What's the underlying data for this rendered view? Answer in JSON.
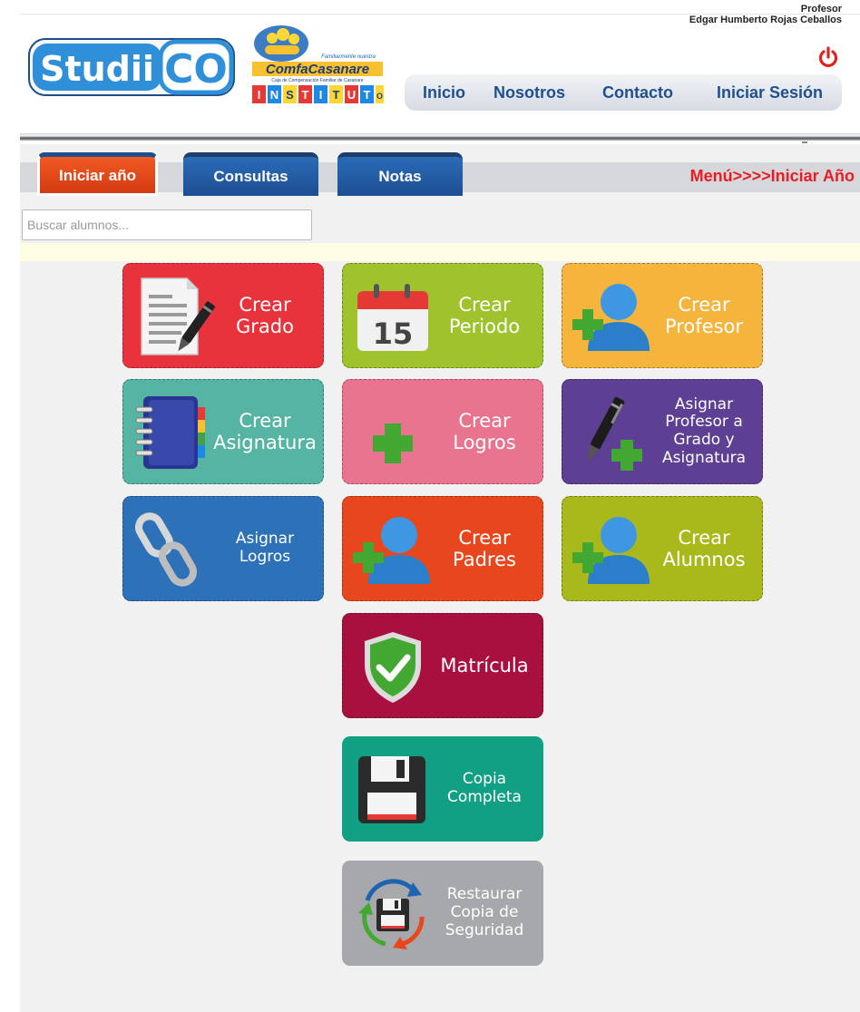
{
  "header": {
    "logo_studii": "Studii CO",
    "logo_comfa": {
      "tagline": "Familiarmente nuestra",
      "brand": "ComfaCasanare",
      "subtitle": "Caja de Compensación Familiar de Casanare",
      "institute": "INSTITUTO"
    },
    "user_role": "Profesor",
    "user_name": "Edgar Humberto Rojas Ceballos",
    "nav": [
      "Inicio",
      "Nosotros",
      "Contacto",
      "Iniciar Sesión"
    ]
  },
  "tabs": [
    {
      "label": "Iniciar año",
      "active": true
    },
    {
      "label": "Consultas",
      "active": false
    },
    {
      "label": "Notas",
      "active": false
    }
  ],
  "breadcrumb": "Menú>>>>Iniciar Año",
  "search": {
    "placeholder": "Buscar alumnos...",
    "value": ""
  },
  "tiles": [
    {
      "label": "Crear\nGrado",
      "icon": "document-pen-icon",
      "color": "#e8333d"
    },
    {
      "label": "Crear\nPeriodo",
      "icon": "calendar-15-icon",
      "color": "#9fc22d"
    },
    {
      "label": "Crear\nProfesor",
      "icon": "user-plus-icon",
      "color": "#f5b43c"
    },
    {
      "label": "Crear\nAsignatura",
      "icon": "notebook-icon",
      "color": "#56b4a2"
    },
    {
      "label": "Crear\nLogros",
      "icon": "plus-icon",
      "color": "#e87490"
    },
    {
      "label": "Asignar\nProfesor a\nGrado y\nAsignatura",
      "icon": "pen-plus-icon",
      "color": "#5d3f94"
    },
    {
      "label": "Asignar\nLogros",
      "icon": "chain-link-icon",
      "color": "#2d72b8"
    },
    {
      "label": "Crear\nPadres",
      "icon": "user-plus-icon",
      "color": "#e8471d"
    },
    {
      "label": "Crear\nAlumnos",
      "icon": "user-plus-icon",
      "color": "#a9b81b"
    },
    {
      "label": "Matrícula",
      "icon": "shield-check-icon",
      "color": "#a8103f"
    },
    {
      "label": "Copia\nCompleta",
      "icon": "floppy-disk-icon",
      "color": "#12a085"
    },
    {
      "label": "Restaurar\nCopia de\nSeguridad",
      "icon": "restore-backup-icon",
      "color": "#a6a8ab"
    }
  ]
}
